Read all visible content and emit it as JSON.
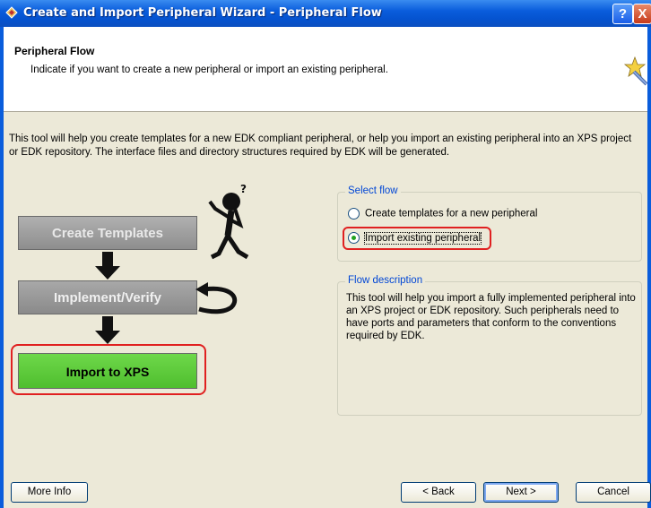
{
  "window": {
    "title": "Create and Import Peripheral Wizard - Peripheral Flow",
    "help_label": "?",
    "close_label": "X"
  },
  "header": {
    "title": "Peripheral Flow",
    "subtitle": "Indicate if you want to create a new peripheral or import an existing peripheral."
  },
  "intro": "This tool will help you create templates for a new EDK compliant peripheral, or help you import an existing peripheral into an XPS project or EDK repository. The interface files and directory structures required by EDK will be generated.",
  "flow_diagram": {
    "create": "Create Templates",
    "implement": "Implement/Verify",
    "import": "Import to XPS"
  },
  "select_flow": {
    "label": "Select flow",
    "options": [
      {
        "label": "Create templates for a new peripheral",
        "selected": false
      },
      {
        "label": "Import existing peripheral",
        "selected": true
      }
    ]
  },
  "flow_description": {
    "label": "Flow description",
    "text": "This tool will help you import a fully implemented peripheral into an XPS project or EDK repository. Such peripherals need to have ports and parameters that conform to the conventions required by EDK."
  },
  "buttons": {
    "more_info": "More Info",
    "back": "< Back",
    "next": "Next >",
    "cancel": "Cancel"
  }
}
